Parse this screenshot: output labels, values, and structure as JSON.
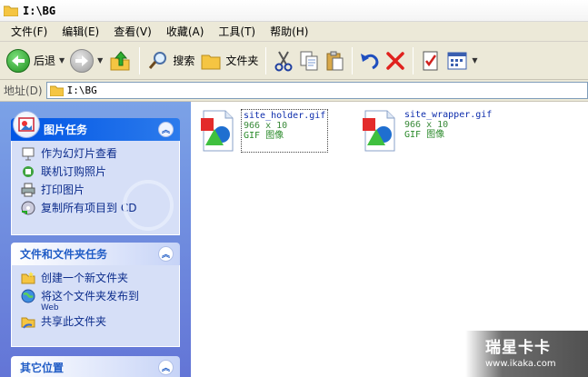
{
  "window": {
    "title": "I:\\BG"
  },
  "menu": [
    "文件(F)",
    "编辑(E)",
    "查看(V)",
    "收藏(A)",
    "工具(T)",
    "帮助(H)"
  ],
  "toolbar": {
    "back_label": "后退",
    "search_label": "搜索",
    "folders_label": "文件夹"
  },
  "address": {
    "label": "地址(D)",
    "path": "I:\\BG"
  },
  "panels": {
    "picture_tasks": {
      "title": "图片任务",
      "items": [
        "作为幻灯片查看",
        "联机订购照片",
        "打印图片",
        "复制所有项目到 CD"
      ]
    },
    "file_tasks": {
      "title": "文件和文件夹任务",
      "items": [
        "创建一个新文件夹",
        "将这个文件夹发布到",
        "Web",
        "共享此文件夹"
      ]
    },
    "other_places": {
      "title": "其它位置"
    }
  },
  "files": [
    {
      "name": "site_holder.gif",
      "size": "966 x 10",
      "type": "GIF 图像"
    },
    {
      "name": "site_wrapper.gif",
      "size": "966 x 10",
      "type": "GIF 图像"
    }
  ],
  "watermark": {
    "title": "瑞星卡卡",
    "url": "www.ikaka.com"
  }
}
